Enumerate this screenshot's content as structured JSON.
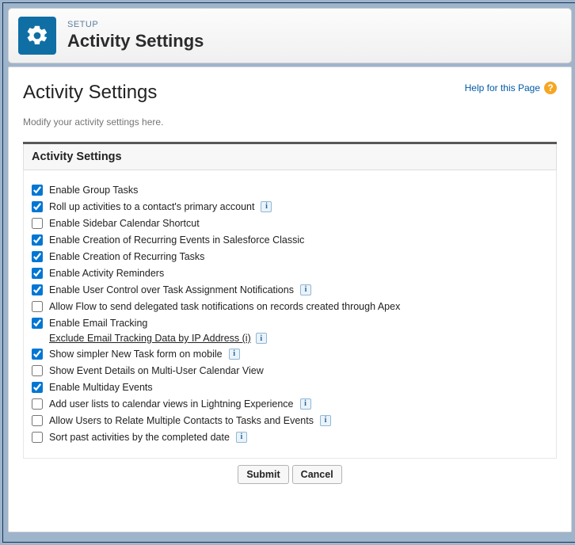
{
  "header": {
    "setup_label": "SETUP",
    "title": "Activity Settings"
  },
  "page": {
    "title": "Activity Settings",
    "help_label": "Help for this Page",
    "subtext": "Modify your activity settings here."
  },
  "section": {
    "title": "Activity Settings",
    "items": [
      {
        "label": "Enable Group Tasks",
        "checked": true,
        "info": false
      },
      {
        "label": "Roll up activities to a contact's primary account",
        "checked": true,
        "info": true
      },
      {
        "label": "Enable Sidebar Calendar Shortcut",
        "checked": false,
        "info": false
      },
      {
        "label": "Enable Creation of Recurring Events in Salesforce Classic",
        "checked": true,
        "info": false
      },
      {
        "label": "Enable Creation of Recurring Tasks",
        "checked": true,
        "info": false
      },
      {
        "label": "Enable Activity Reminders",
        "checked": true,
        "info": false
      },
      {
        "label": "Enable User Control over Task Assignment Notifications",
        "checked": true,
        "info": true
      },
      {
        "label": "Allow Flow to send delegated task notifications on records created through Apex",
        "checked": false,
        "info": false
      },
      {
        "label": "Enable Email Tracking",
        "checked": true,
        "info": false,
        "sub_link": "Exclude Email Tracking Data by IP Address (i)",
        "sub_info": true
      },
      {
        "label": "Show simpler New Task form on mobile",
        "checked": true,
        "info": true
      },
      {
        "label": "Show Event Details on Multi-User Calendar View",
        "checked": false,
        "info": false
      },
      {
        "label": "Enable Multiday Events",
        "checked": true,
        "info": false
      },
      {
        "label": "Add user lists to calendar views in Lightning Experience",
        "checked": false,
        "info": true
      },
      {
        "label": "Allow Users to Relate Multiple Contacts to Tasks and Events",
        "checked": false,
        "info": true
      },
      {
        "label": "Sort past activities by the completed date",
        "checked": false,
        "info": true
      }
    ]
  },
  "buttons": {
    "submit": "Submit",
    "cancel": "Cancel"
  }
}
